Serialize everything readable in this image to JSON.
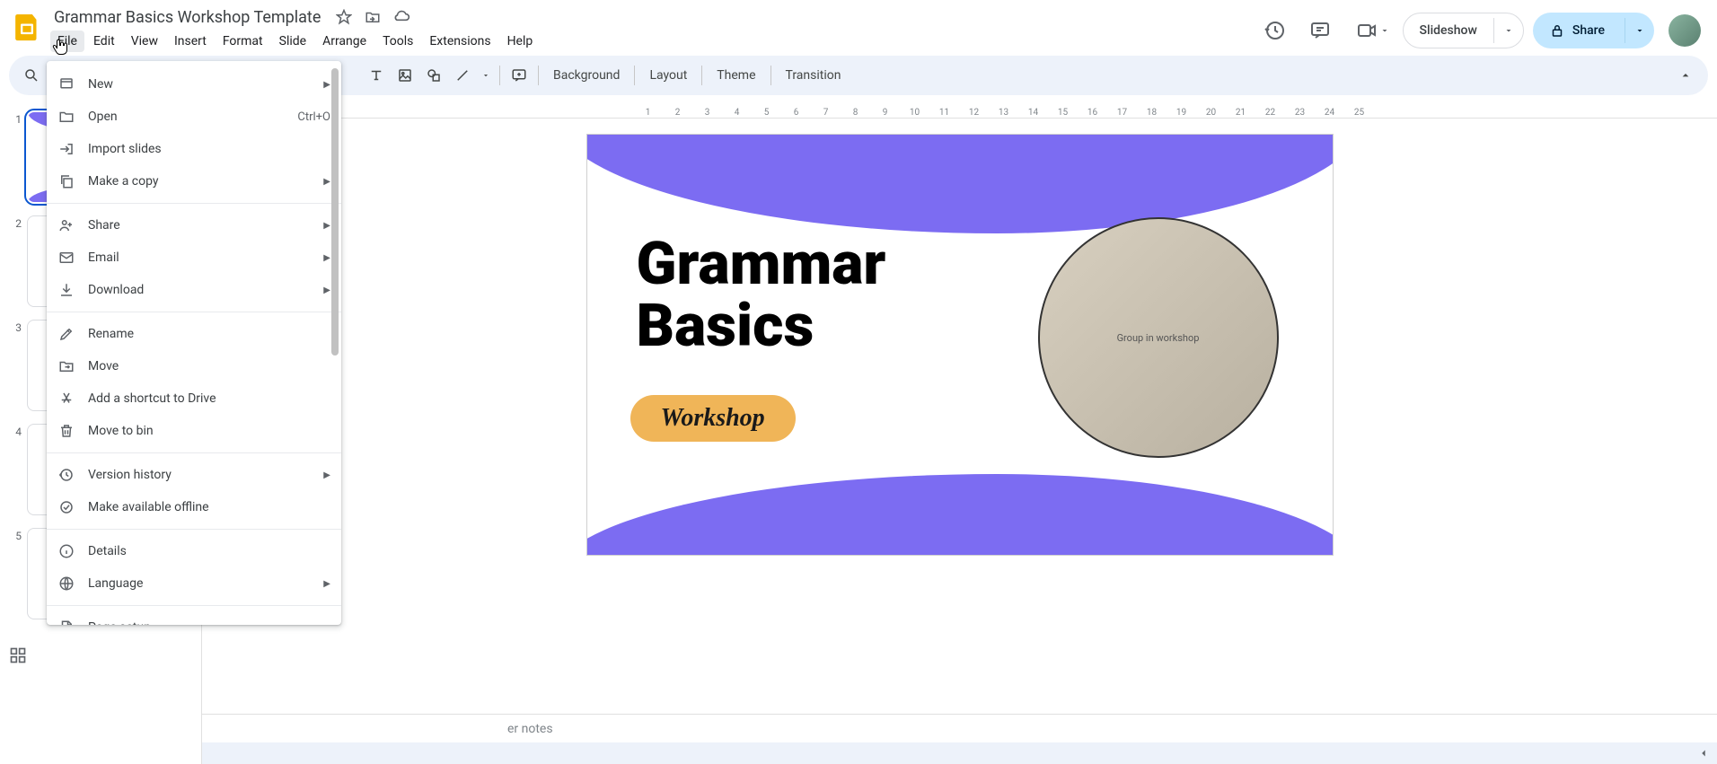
{
  "doc": {
    "title": "Grammar Basics Workshop Template"
  },
  "menus": {
    "file": "File",
    "edit": "Edit",
    "view": "View",
    "insert": "Insert",
    "format": "Format",
    "slide": "Slide",
    "arrange": "Arrange",
    "tools": "Tools",
    "extensions": "Extensions",
    "help": "Help"
  },
  "header_buttons": {
    "slideshow": "Slideshow",
    "share": "Share"
  },
  "toolbar": {
    "background": "Background",
    "layout": "Layout",
    "theme": "Theme",
    "transition": "Transition"
  },
  "file_menu": {
    "new": "New",
    "open": "Open",
    "open_shortcut": "Ctrl+O",
    "import": "Import slides",
    "make_copy": "Make a copy",
    "share": "Share",
    "email": "Email",
    "download": "Download",
    "rename": "Rename",
    "move": "Move",
    "shortcut": "Add a shortcut to Drive",
    "trash": "Move to bin",
    "version": "Version history",
    "offline": "Make available offline",
    "details": "Details",
    "language": "Language",
    "page_setup": "Page setup"
  },
  "slide_content": {
    "title_line1": "Grammar",
    "title_line2": "Basics",
    "badge": "Workshop",
    "image_alt": "Group in workshop"
  },
  "ruler": [
    "1",
    "2",
    "3",
    "4",
    "5",
    "6",
    "7",
    "8",
    "9",
    "10",
    "11",
    "12",
    "13",
    "14",
    "15",
    "16",
    "17",
    "18",
    "19",
    "20",
    "21",
    "22",
    "23",
    "24",
    "25"
  ],
  "thumbs": {
    "count": 5,
    "selected": 1
  },
  "notes_placeholder": "er notes"
}
